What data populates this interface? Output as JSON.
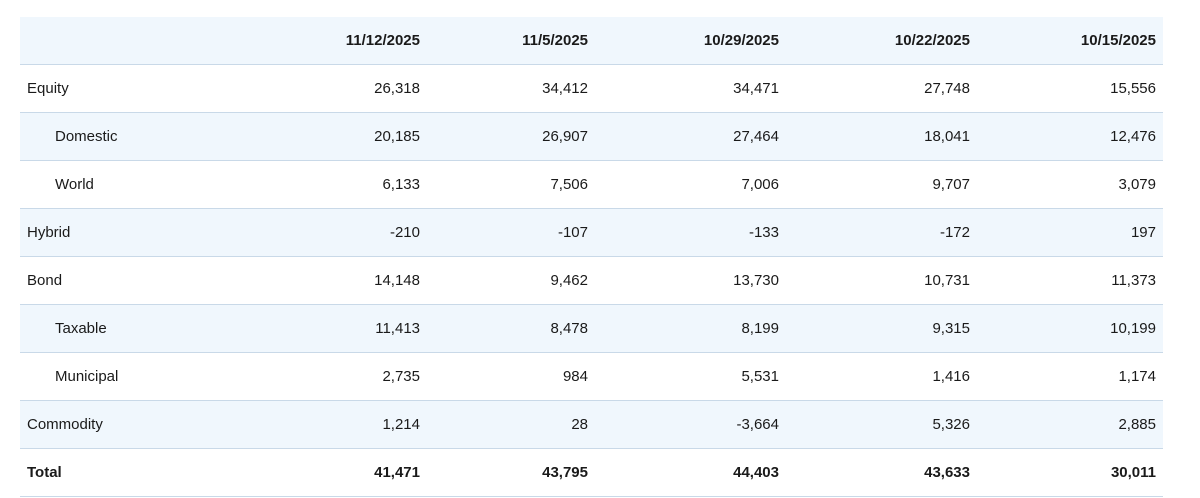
{
  "table": {
    "headers": [
      "",
      "11/12/2025",
      "11/5/2025",
      "10/29/2025",
      "10/22/2025",
      "10/15/2025"
    ],
    "rows": [
      {
        "label": "Equity",
        "values": [
          "26,318",
          "34,412",
          "34,471",
          "27,748",
          "15,556"
        ]
      },
      {
        "label": "Domestic",
        "values": [
          "20,185",
          "26,907",
          "27,464",
          "18,041",
          "12,476"
        ]
      },
      {
        "label": "World",
        "values": [
          "6,133",
          "7,506",
          "7,006",
          "9,707",
          "3,079"
        ]
      },
      {
        "label": "Hybrid",
        "values": [
          "-210",
          "-107",
          "-133",
          "-172",
          "197"
        ]
      },
      {
        "label": "Bond",
        "values": [
          "14,148",
          "9,462",
          "13,730",
          "10,731",
          "11,373"
        ]
      },
      {
        "label": "Taxable",
        "values": [
          "11,413",
          "8,478",
          "8,199",
          "9,315",
          "10,199"
        ]
      },
      {
        "label": "Municipal",
        "values": [
          "2,735",
          "984",
          "5,531",
          "1,416",
          "1,174"
        ]
      },
      {
        "label": "Commodity",
        "values": [
          "1,214",
          "28",
          "-3,664",
          "5,326",
          "2,885"
        ]
      },
      {
        "label": "Total",
        "values": [
          "41,471",
          "43,795",
          "44,403",
          "43,633",
          "30,011"
        ]
      }
    ]
  },
  "colors": {
    "header_bg": "#f0f7fd",
    "row_alt_bg": "#f0f7fd",
    "border": "#c9d9e8",
    "text": "#1a1a1a"
  }
}
